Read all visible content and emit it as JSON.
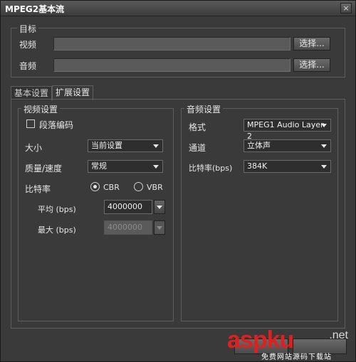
{
  "window": {
    "title": "MPEG2基本流",
    "close_label": "×"
  },
  "target_group": {
    "label": "目标",
    "video_label": "视频",
    "video_path": "",
    "audio_label": "音频",
    "audio_path": "",
    "browse_label": "选择..."
  },
  "tabs": [
    {
      "label": "基本设置",
      "active": false
    },
    {
      "label": "扩展设置",
      "active": true
    }
  ],
  "video_settings": {
    "label": "视频设置",
    "segment_encoding_label": "段落编码",
    "segment_encoding_checked": false,
    "size_label": "大小",
    "size_value": "当前设置",
    "quality_label": "质量/速度",
    "quality_value": "常规",
    "bitrate_label": "比特率",
    "cbr_label": "CBR",
    "vbr_label": "VBR",
    "bitrate_mode": "CBR",
    "avg_label": "平均 (bps)",
    "avg_value": "4000000",
    "max_label": "最大 (bps)",
    "max_value": "4000000"
  },
  "audio_settings": {
    "label": "音频设置",
    "format_label": "格式",
    "format_value": "MPEG1 Audio Layer-2",
    "channel_label": "通道",
    "channel_value": "立体声",
    "bitrate_label": "比特率(bps)",
    "bitrate_value": "384K"
  },
  "watermark": {
    "main": "aspku",
    "net": ".net",
    "sub": "免费网站源码下载站"
  }
}
